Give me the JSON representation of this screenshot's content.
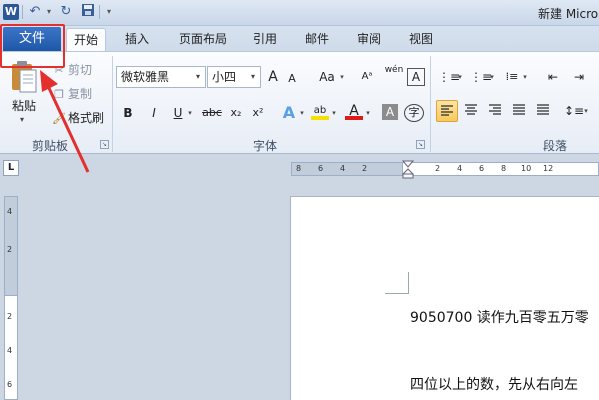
{
  "window": {
    "doc_title": "新建 Micro"
  },
  "tabs": [
    {
      "label": "开始",
      "active": true
    },
    {
      "label": "插入"
    },
    {
      "label": "页面布局"
    },
    {
      "label": "引用"
    },
    {
      "label": "邮件"
    },
    {
      "label": "审阅"
    },
    {
      "label": "视图"
    }
  ],
  "file_tab": {
    "label": "文件"
  },
  "clipboard": {
    "paste_label": "粘贴",
    "cut_label": "剪切",
    "copy_label": "复制",
    "format_painter_label": "格式刷",
    "group_label": "剪贴板"
  },
  "font": {
    "font_name": "微软雅黑",
    "font_size": "小四",
    "grow": "A",
    "shrink": "A",
    "case": "Aa",
    "wen": "wén",
    "border_char": "A",
    "bold": "B",
    "italic": "I",
    "underline": "U",
    "strike": "abc",
    "sub": "x₂",
    "sup": "x²",
    "effects": "A",
    "highlight": "ab",
    "color": "A",
    "shade": "A",
    "enclose": "字",
    "group_label": "字体"
  },
  "paragraph": {
    "group_label": "段落"
  },
  "ruler": {
    "h_numbers": [
      "8",
      "6",
      "4",
      "2",
      "2",
      "4",
      "6",
      "8",
      "10",
      "12"
    ],
    "v_numbers": [
      "4",
      "2",
      "2",
      "4",
      "6"
    ],
    "corner": "L"
  },
  "document": {
    "line1": "9050700 读作九百零五万零",
    "line2": "四位以上的数，先从右向左"
  },
  "colors": {
    "file_tab": "#1f57a8",
    "highlight_box": "#e3302f",
    "annotation_arrow": "#e3302f",
    "selected_button": "#f8c95c"
  }
}
